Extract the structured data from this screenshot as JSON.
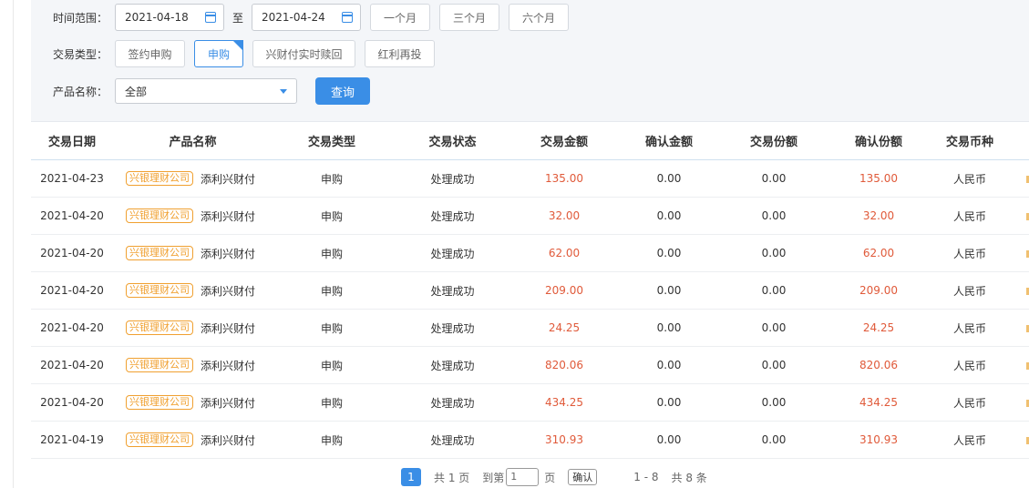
{
  "filters": {
    "time_range_label": "时间范围：",
    "date_start": "2021-04-18",
    "date_to": "至",
    "date_end": "2021-04-24",
    "quick_ranges": [
      "一个月",
      "三个月",
      "六个月"
    ],
    "type_label": "交易类型：",
    "types": [
      "签约申购",
      "申购",
      "兴财付实时赎回",
      "红利再投"
    ],
    "product_label": "产品名称：",
    "product_value": "全部",
    "query_label": "查询"
  },
  "table": {
    "headers": [
      "交易日期",
      "产品名称",
      "交易类型",
      "交易状态",
      "交易金额",
      "确认金额",
      "交易份额",
      "确认份额",
      "交易币种"
    ],
    "tag": "兴银理财公司",
    "rows": [
      {
        "date": "2021-04-23",
        "product": "添利兴财付",
        "type": "申购",
        "status": "处理成功",
        "amount": "135.00",
        "confirm_amount": "0.00",
        "shares": "0.00",
        "confirm_shares": "135.00",
        "currency": "人民币"
      },
      {
        "date": "2021-04-20",
        "product": "添利兴财付",
        "type": "申购",
        "status": "处理成功",
        "amount": "32.00",
        "confirm_amount": "0.00",
        "shares": "0.00",
        "confirm_shares": "32.00",
        "currency": "人民币"
      },
      {
        "date": "2021-04-20",
        "product": "添利兴财付",
        "type": "申购",
        "status": "处理成功",
        "amount": "62.00",
        "confirm_amount": "0.00",
        "shares": "0.00",
        "confirm_shares": "62.00",
        "currency": "人民币"
      },
      {
        "date": "2021-04-20",
        "product": "添利兴财付",
        "type": "申购",
        "status": "处理成功",
        "amount": "209.00",
        "confirm_amount": "0.00",
        "shares": "0.00",
        "confirm_shares": "209.00",
        "currency": "人民币"
      },
      {
        "date": "2021-04-20",
        "product": "添利兴财付",
        "type": "申购",
        "status": "处理成功",
        "amount": "24.25",
        "confirm_amount": "0.00",
        "shares": "0.00",
        "confirm_shares": "24.25",
        "currency": "人民币"
      },
      {
        "date": "2021-04-20",
        "product": "添利兴财付",
        "type": "申购",
        "status": "处理成功",
        "amount": "820.06",
        "confirm_amount": "0.00",
        "shares": "0.00",
        "confirm_shares": "820.06",
        "currency": "人民币"
      },
      {
        "date": "2021-04-20",
        "product": "添利兴财付",
        "type": "申购",
        "status": "处理成功",
        "amount": "434.25",
        "confirm_amount": "0.00",
        "shares": "0.00",
        "confirm_shares": "434.25",
        "currency": "人民币"
      },
      {
        "date": "2021-04-19",
        "product": "添利兴财付",
        "type": "申购",
        "status": "处理成功",
        "amount": "310.93",
        "confirm_amount": "0.00",
        "shares": "0.00",
        "confirm_shares": "310.93",
        "currency": "人民币"
      }
    ]
  },
  "pager": {
    "current": "1",
    "total_pages": "共 1 页",
    "goto_prefix": "到第",
    "goto_value": "1",
    "goto_suffix": "页",
    "confirm": "确认",
    "range": "1 - 8",
    "total": "共 8 条"
  }
}
